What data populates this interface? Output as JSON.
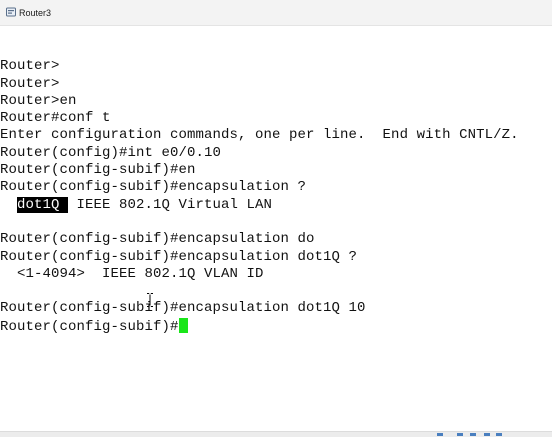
{
  "window": {
    "title": "Router3",
    "icon": "router-app-icon"
  },
  "terminal": {
    "lines": [
      {
        "text": ""
      },
      {
        "text": "Router>"
      },
      {
        "text": "Router>"
      },
      {
        "text": "Router>en"
      },
      {
        "text": "Router#conf t"
      },
      {
        "text": "Enter configuration commands, one per line.  End with CNTL/Z."
      },
      {
        "text": "Router(config)#int e0/0.10"
      },
      {
        "text": "Router(config-subif)#en"
      },
      {
        "text": "Router(config-subif)#encapsulation ?"
      },
      {
        "pre": "  ",
        "highlight": "dot1Q ",
        "text": " IEEE 802.1Q Virtual LAN"
      },
      {
        "text": ""
      },
      {
        "text": "Router(config-subif)#encapsulation do"
      },
      {
        "text": "Router(config-subif)#encapsulation dot1Q ?"
      },
      {
        "text": "  <1-4094>  IEEE 802.1Q VLAN ID"
      },
      {
        "text": ""
      },
      {
        "text": "Router(config-subif)#encapsulation dot1Q 10"
      },
      {
        "text": "Router(config-subif)#",
        "cursor": true
      }
    ],
    "cursor_color": "#19e619"
  }
}
